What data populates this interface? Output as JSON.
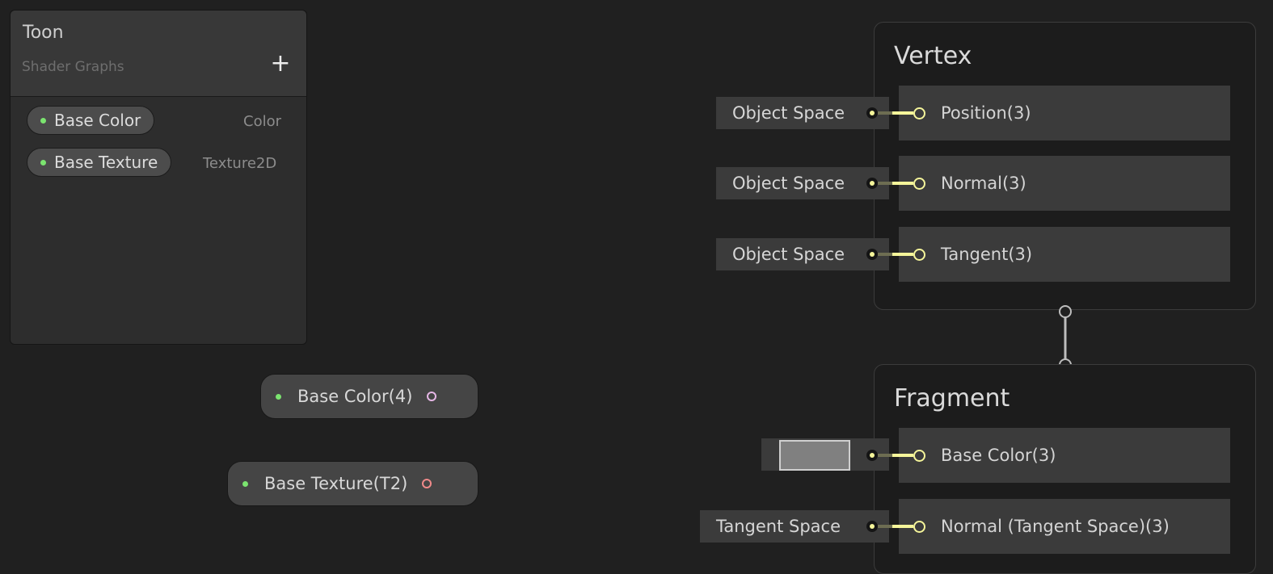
{
  "blackboard": {
    "title": "Toon",
    "subtitle": "Shader Graphs",
    "add_label": "+",
    "properties": [
      {
        "name": "Base Color",
        "type": "Color"
      },
      {
        "name": "Base Texture",
        "type": "Texture2D"
      }
    ]
  },
  "graph_nodes": {
    "base_color": {
      "label": "Base Color(4)",
      "port_color": "#e6b7e6"
    },
    "base_texture": {
      "label": "Base Texture(T2)",
      "port_color": "#f08a8a"
    }
  },
  "vertex": {
    "title": "Vertex",
    "blocks": [
      {
        "label": "Position(3)",
        "input": "Object Space"
      },
      {
        "label": "Normal(3)",
        "input": "Object Space"
      },
      {
        "label": "Tangent(3)",
        "input": "Object Space"
      }
    ]
  },
  "fragment": {
    "title": "Fragment",
    "blocks": [
      {
        "label": "Base Color(3)",
        "input_color": "#808080"
      },
      {
        "label": "Normal (Tangent Space)(3)",
        "input": "Tangent Space"
      }
    ]
  },
  "colors": {
    "port_yellow": "#f5f59a",
    "property_green": "#7be46f",
    "background": "#202020"
  }
}
